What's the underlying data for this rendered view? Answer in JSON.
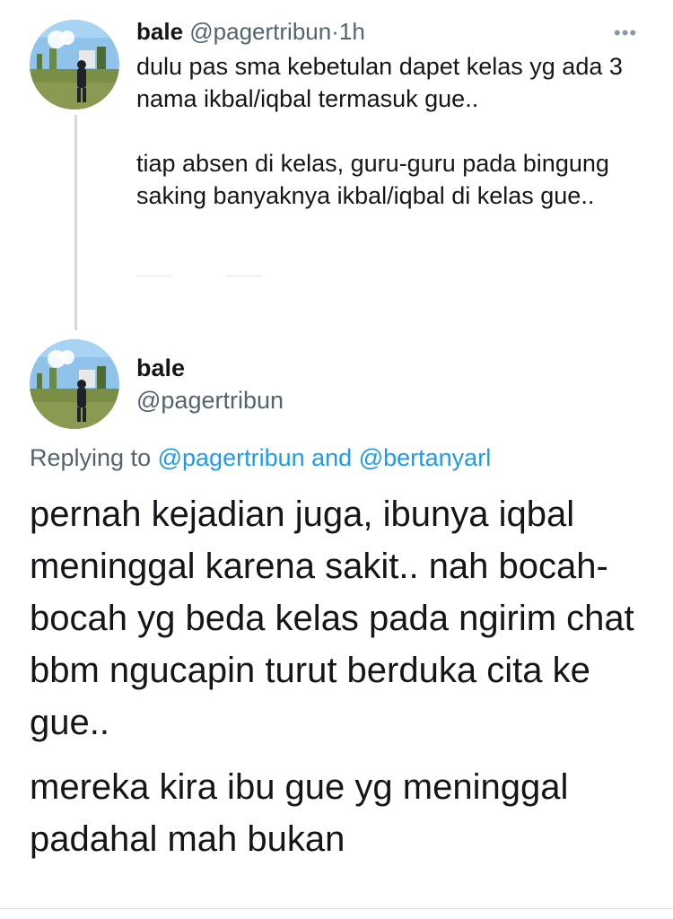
{
  "thread_tweet": {
    "display_name": "bale",
    "handle": "@pagertribun",
    "separator": "·",
    "time": "1h",
    "more_icon": "more-horizontal-icon",
    "paragraphs": [
      "dulu pas sma kebetulan dapet kelas yg ada 3 nama ikbal/iqbal termasuk gue..",
      "tiap absen di kelas, guru-guru pada bingung saking banyaknya ikbal/iqbal di kelas gue.."
    ]
  },
  "main_tweet": {
    "display_name": "bale",
    "handle": "@pagertribun",
    "replying_prefix": "Replying to",
    "reply_mention_1": "@pagertribun",
    "reply_and": "and",
    "reply_mention_2": "@bertanyarl",
    "paragraphs": [
      "pernah kejadian juga, ibunya iqbal meninggal karena sakit.. nah bocah-bocah yg beda kelas pada ngirim chat bbm ngucapin turut berduka cita ke gue..",
      "mereka kira ibu gue yg meninggal padahal mah bukan"
    ]
  },
  "colors": {
    "text": "#14171a",
    "secondary": "#536471",
    "link": "#1d9bf0",
    "thread_line": "#cfd9de"
  }
}
